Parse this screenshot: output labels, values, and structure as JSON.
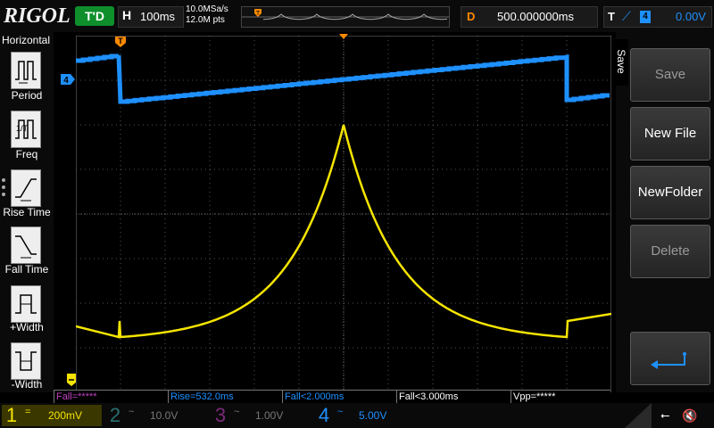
{
  "brand": "RIGOL",
  "top": {
    "trigger_status": "T'D",
    "horizontal_letter": "H",
    "timebase": "100ms",
    "sample_rate": "10.0MSa/s",
    "memory_depth": "12.0M pts",
    "delay_letter": "D",
    "delay_value": "500.000000ms",
    "trigger_letter": "T",
    "trigger_source": "4",
    "trigger_level": "0.00V"
  },
  "left_menu": {
    "title": "Horizontal",
    "items": [
      {
        "label": "Period"
      },
      {
        "label": "Freq"
      },
      {
        "label": "Rise Time"
      },
      {
        "label": "Fall Time"
      },
      {
        "label": "+Width"
      },
      {
        "label": "-Width"
      }
    ]
  },
  "right_menu": {
    "tab": "Save",
    "buttons": [
      {
        "label": "Save",
        "enabled": false
      },
      {
        "label": "New File",
        "enabled": true
      },
      {
        "label": "NewFolder",
        "enabled": true
      },
      {
        "label": "Delete",
        "enabled": false
      }
    ],
    "back_icon": "return-arrow-icon"
  },
  "markers": {
    "trigger_pos": "T",
    "ch4_ref": "4"
  },
  "measurements": [
    {
      "text": "Fall=*****",
      "color": "#c040c0"
    },
    {
      "text": "Rise=532.0ms",
      "color": "#1e90ff"
    },
    {
      "text": "Fall<2.000ms",
      "color": "#1e90ff"
    },
    {
      "text": "Fall<3.000ms",
      "color": "#ffffff"
    },
    {
      "text": "Vpp=*****",
      "color": "#ffffff"
    }
  ],
  "channels": [
    {
      "num": "1",
      "coupling": "=",
      "scale": "200mV",
      "color": "#f5e400",
      "active": true
    },
    {
      "num": "2",
      "coupling": "~",
      "scale": "10.0V",
      "color": "#2aa0a0",
      "active": false
    },
    {
      "num": "3",
      "coupling": "~",
      "scale": "1.00V",
      "color": "#c040c0",
      "active": false
    },
    {
      "num": "4",
      "coupling": "~",
      "scale": "5.00V",
      "color": "#1e90ff",
      "active": true
    }
  ],
  "colors": {
    "ch1": "#f5e400",
    "ch4": "#1e90ff",
    "trigger": "#ff8a00",
    "grid": "#555555"
  }
}
